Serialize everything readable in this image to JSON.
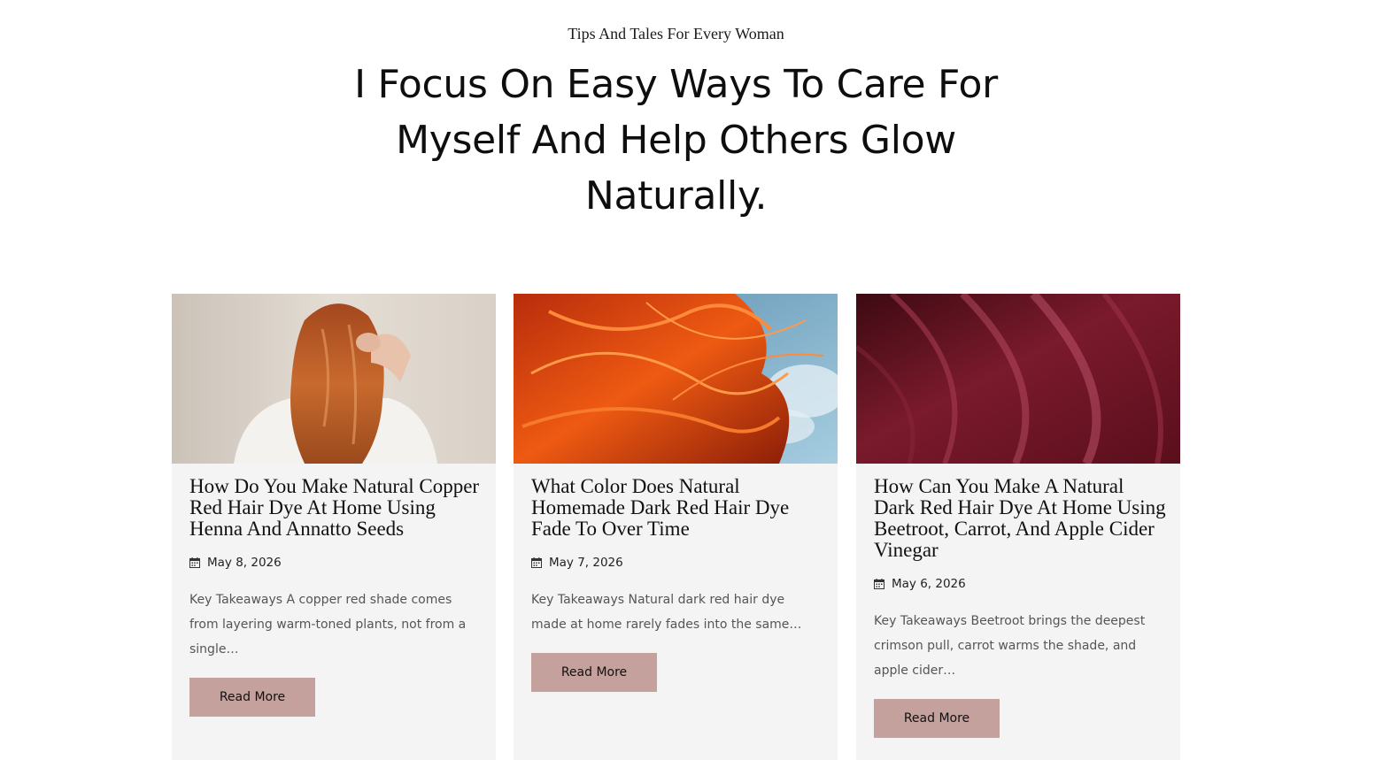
{
  "hero": {
    "tagline": "Tips And Tales For Every Woman",
    "headline": "I Focus On Easy Ways To Care For Myself And Help Others Glow Naturally."
  },
  "posts": [
    {
      "title": "How Do You Make Natural Copper Red Hair Dye At Home Using Henna And Annatto Seeds",
      "date": "May 8, 2026",
      "excerpt": "Key Takeaways A copper red shade comes from layering warm-toned plants, not from a single…",
      "button": "Read More",
      "image": "copper-hair-woman-photo"
    },
    {
      "title": "What Color Does Natural Homemade Dark Red Hair Dye Fade To Over Time",
      "date": "May 7, 2026",
      "excerpt": "Key Takeaways Natural dark red hair dye made at home rarely fades into the same…",
      "button": "Read More",
      "image": "orange-hair-sky-photo"
    },
    {
      "title": "How Can You Make A Natural Dark Red Hair Dye At Home Using Beetroot, Carrot, And Apple Cider Vinegar",
      "date": "May 6, 2026",
      "excerpt": "Key Takeaways Beetroot brings the deepest crimson pull, carrot warms the shade, and apple cider…",
      "button": "Read More",
      "image": "burgundy-hair-closeup-photo"
    }
  ],
  "colors": {
    "button_bg": "#c4a19d",
    "card_bg": "#f4f4f4"
  }
}
